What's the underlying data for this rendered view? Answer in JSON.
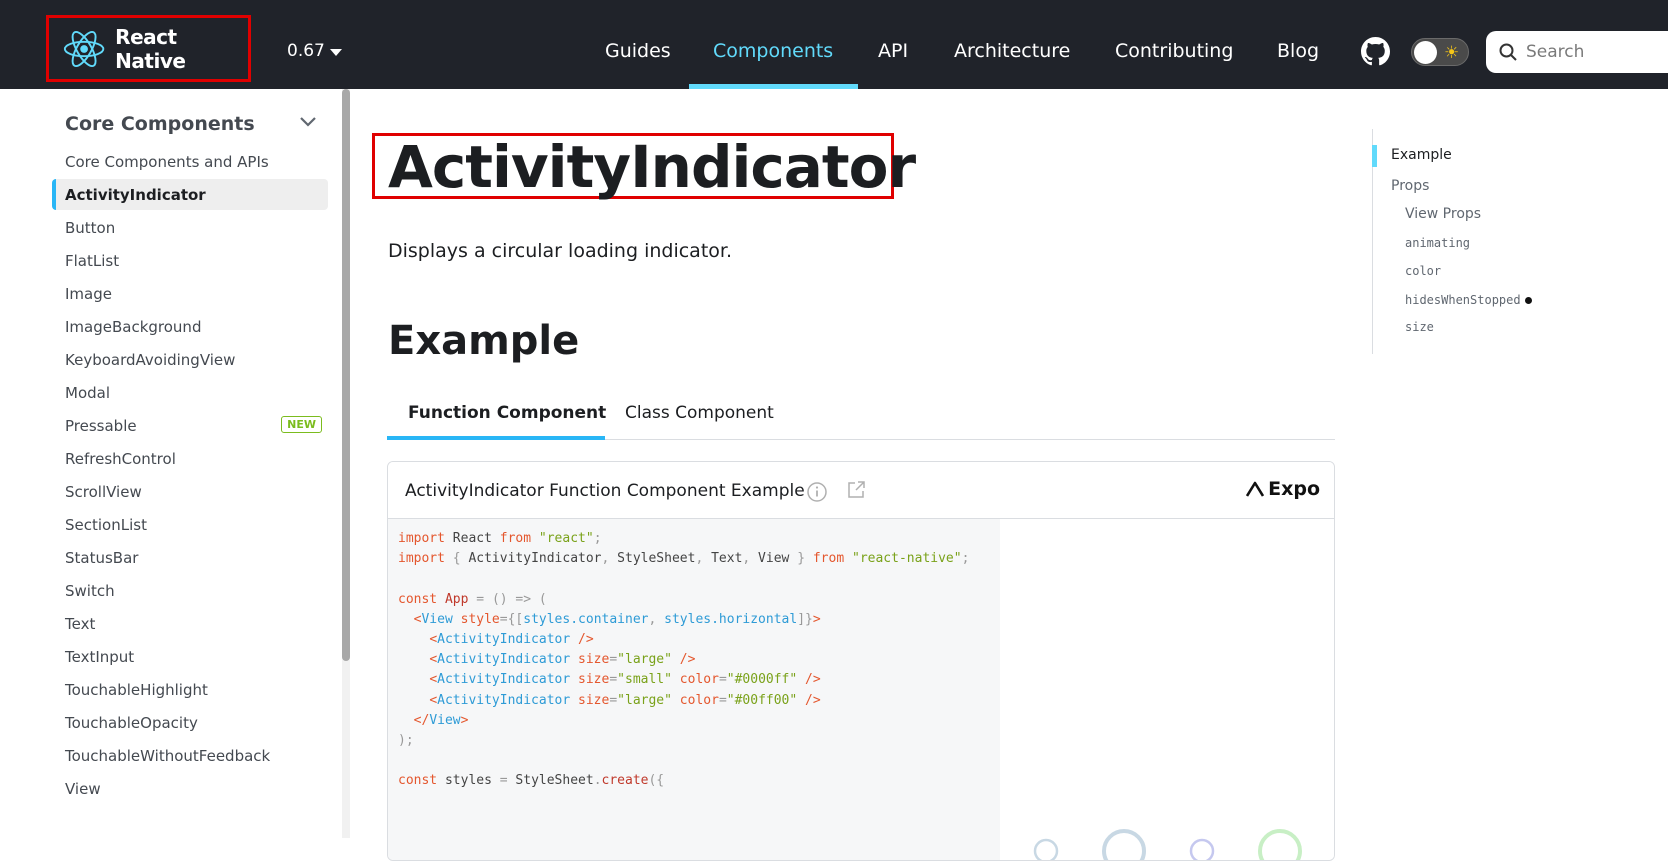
{
  "navbar": {
    "brand": "React Native",
    "version": "0.67",
    "links": [
      "Guides",
      "Components",
      "API",
      "Architecture",
      "Contributing",
      "Blog"
    ],
    "active_link": "Components",
    "search_placeholder": "Search",
    "icons": {
      "github": "github-icon",
      "theme": "sun-icon",
      "search": "search-icon"
    }
  },
  "sidebar": {
    "heading": "Core Components",
    "items": [
      {
        "label": "Core Components and APIs"
      },
      {
        "label": "ActivityIndicator",
        "active": true
      },
      {
        "label": "Button"
      },
      {
        "label": "FlatList"
      },
      {
        "label": "Image"
      },
      {
        "label": "ImageBackground"
      },
      {
        "label": "KeyboardAvoidingView"
      },
      {
        "label": "Modal"
      },
      {
        "label": "Pressable",
        "badge": "NEW"
      },
      {
        "label": "RefreshControl"
      },
      {
        "label": "ScrollView"
      },
      {
        "label": "SectionList"
      },
      {
        "label": "StatusBar"
      },
      {
        "label": "Switch"
      },
      {
        "label": "Text"
      },
      {
        "label": "TextInput"
      },
      {
        "label": "TouchableHighlight"
      },
      {
        "label": "TouchableOpacity"
      },
      {
        "label": "TouchableWithoutFeedback"
      },
      {
        "label": "View"
      }
    ]
  },
  "main": {
    "title": "ActivityIndicator",
    "lead": "Displays a circular loading indicator.",
    "example_heading": "Example",
    "tabs": [
      "Function Component",
      "Class Component"
    ],
    "snack": {
      "title": "ActivityIndicator Function Component Example",
      "provider": "Expo"
    }
  },
  "toc": {
    "items": [
      "Example",
      "Props",
      "View Props",
      "animating",
      "color",
      "hidesWhenStopped",
      "size"
    ]
  },
  "colors": {
    "accent": "#61dafb",
    "navbar": "#20232a",
    "highlight_box": "#e00000",
    "badge": "#7bbc1e"
  }
}
